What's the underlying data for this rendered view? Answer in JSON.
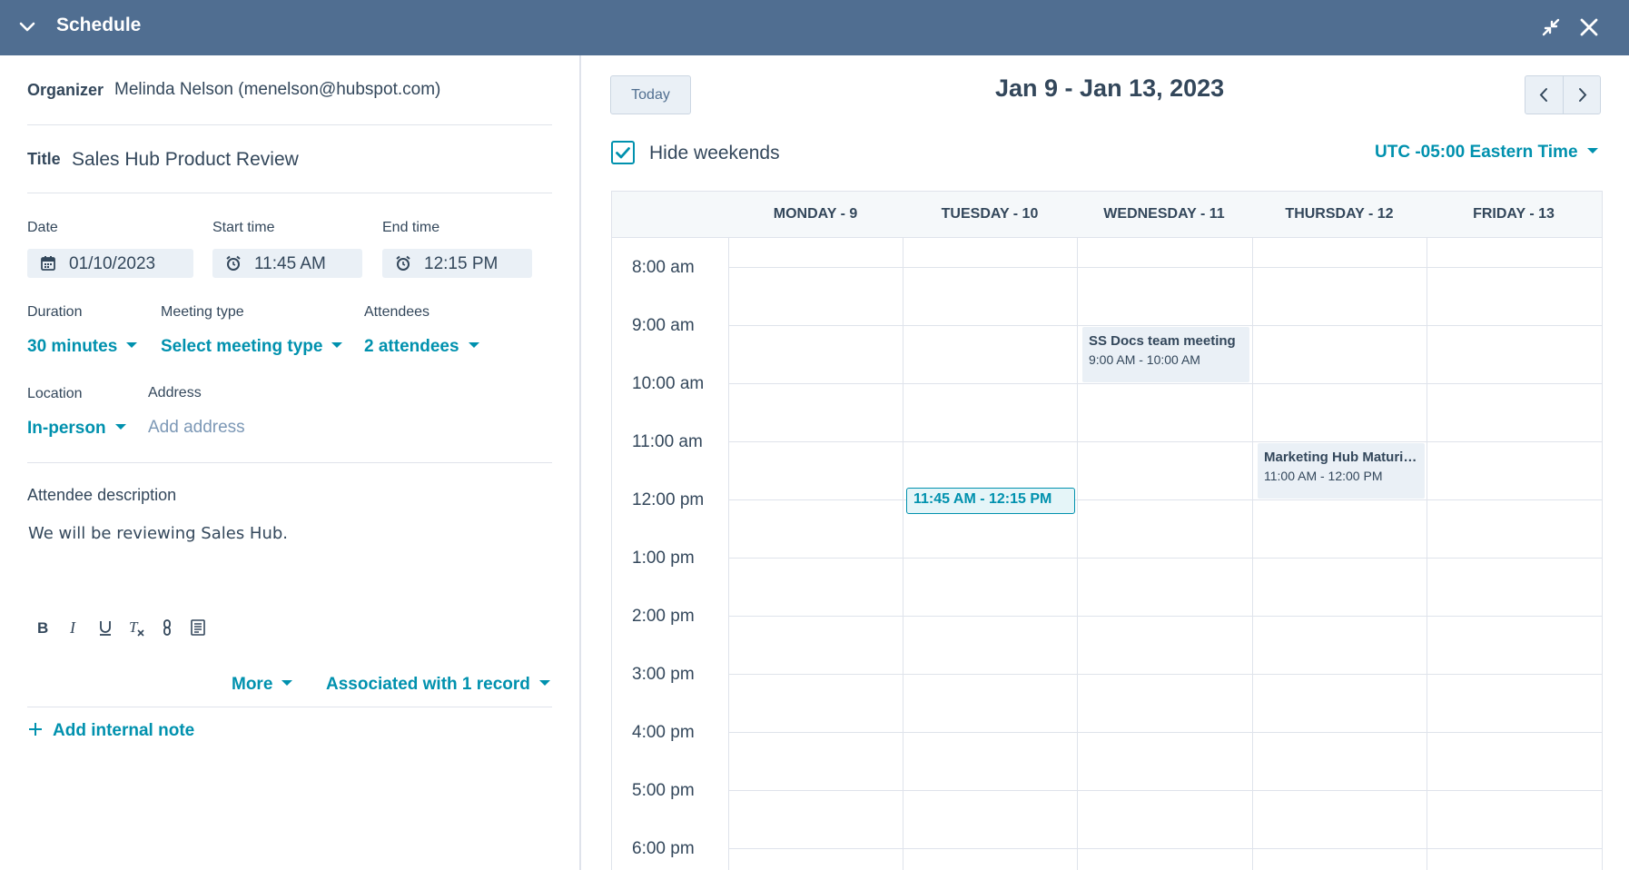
{
  "header": {
    "title": "Schedule"
  },
  "form": {
    "organizer_label": "Organizer",
    "organizer_value": "Melinda Nelson (menelson@hubspot.com)",
    "title_label": "Title",
    "title_value": "Sales Hub Product Review",
    "date_label": "Date",
    "date_value": "01/10/2023",
    "start_label": "Start time",
    "start_value": "11:45 AM",
    "end_label": "End time",
    "end_value": "12:15 PM",
    "duration_label": "Duration",
    "duration_value": "30 minutes",
    "meeting_type_label": "Meeting type",
    "meeting_type_value": "Select meeting type",
    "attendees_label": "Attendees",
    "attendees_value": "2 attendees",
    "location_label": "Location",
    "location_value": "In-person",
    "address_label": "Address",
    "address_placeholder": "Add address",
    "description_label": "Attendee description",
    "description_value": "We will be reviewing Sales Hub.",
    "toolbar": {
      "more_label": "More",
      "associated_label": "Associated with 1 record"
    },
    "add_note_label": "Add internal note"
  },
  "calendar": {
    "today_label": "Today",
    "range_title": "Jan 9 - Jan 13, 2023",
    "hide_weekends_label": "Hide weekends",
    "hide_weekends_checked": true,
    "timezone_label": "UTC -05:00 Eastern Time",
    "days": [
      "MONDAY - 9",
      "TUESDAY - 10",
      "WEDNESDAY - 11",
      "THURSDAY - 12",
      "FRIDAY - 13"
    ],
    "times": [
      "8:00 am",
      "9:00 am",
      "10:00 am",
      "11:00 am",
      "12:00 pm",
      "1:00 pm",
      "2:00 pm",
      "3:00 pm",
      "4:00 pm",
      "5:00 pm",
      "6:00 pm"
    ],
    "events": [
      {
        "title": "SS Docs team meeting",
        "time": "9:00 AM - 10:00 AM"
      },
      {
        "title": "Marketing Hub Maturity Review",
        "time": "11:00 AM - 12:00 PM"
      }
    ],
    "new_event_label": "11:45 AM - 12:15 PM"
  },
  "colors": {
    "header_bg": "#506e91",
    "accent": "#0091ae",
    "event_bg": "#eaf0f6"
  }
}
